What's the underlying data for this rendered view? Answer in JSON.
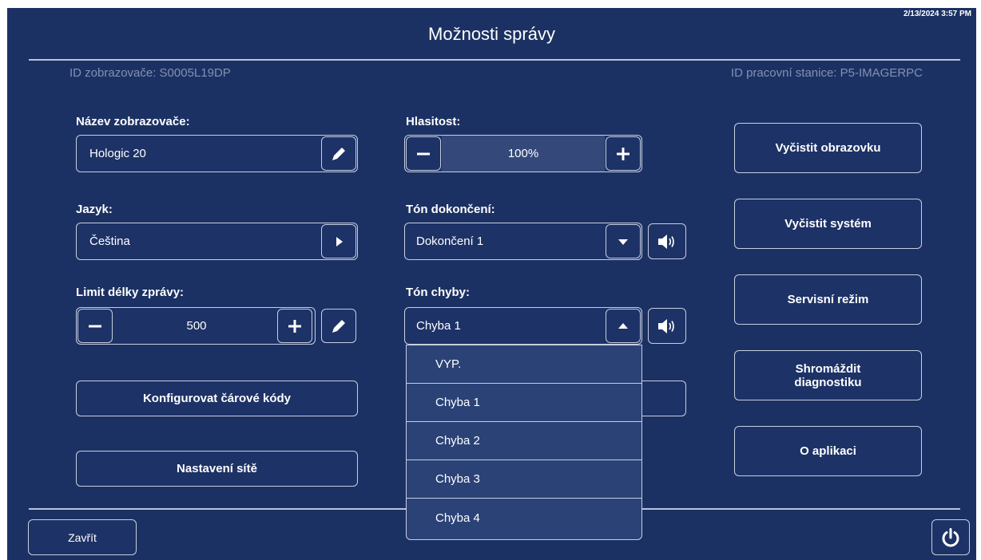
{
  "header": {
    "title": "Možnosti správy",
    "datetime": "2/13/2024 3:57 PM"
  },
  "ids": {
    "display_id": "ID zobrazovače: S0005L19DP",
    "workstation_id": "ID pracovní stanice: P5-IMAGERPC"
  },
  "display_name": {
    "label": "Název zobrazovače:",
    "value": "Hologic 20",
    "edit_icon": "pencil-icon"
  },
  "language": {
    "label": "Jazyk:",
    "value": "Čeština",
    "icon": "triangle-right-icon"
  },
  "message_length": {
    "label": "Limit délky zprávy:",
    "value": "500"
  },
  "volume": {
    "label": "Hlasitost:",
    "value": "100%",
    "level": 1.0
  },
  "completion_tone": {
    "label": "Tón dokončení:",
    "value": "Dokončení 1"
  },
  "error_tone": {
    "label": "Tón chyby:",
    "value": "Chyba 1",
    "options": [
      "VYP.",
      "Chyba 1",
      "Chyba 2",
      "Chyba 3",
      "Chyba 4"
    ]
  },
  "buttons": {
    "configure_barcodes": "Konfigurovat čárové kódy",
    "network_settings": "Nastavení sítě",
    "clear_screen": "Vyčistit obrazovku",
    "clear_system": "Vyčistit systém",
    "service_mode": "Servisní režim",
    "collect_diagnostics_1": "Shromáždit",
    "collect_diagnostics_2": "diagnostiku",
    "about": "O aplikaci",
    "close": "Zavřít"
  },
  "colors": {
    "background": "#1c3163",
    "border": "#c7cfe0",
    "dim_text": "#8291b3",
    "volume_fill": "#34497a"
  }
}
